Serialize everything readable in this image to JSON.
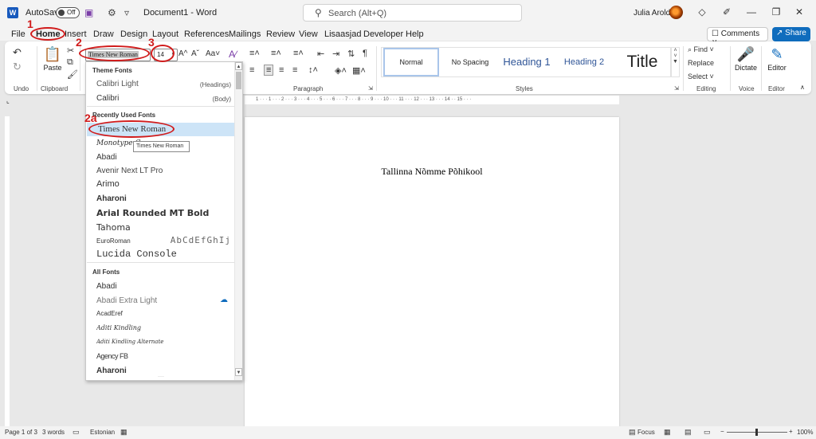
{
  "titlebar": {
    "app_icon": "W",
    "autosave_label": "AutoSave",
    "autosave_state": "Off",
    "doc_title": "Document1  -  Word",
    "search_placeholder": "Search (Alt+Q)",
    "user_name": "Julia Arold",
    "save_icon": "💾",
    "undo_icon": "⚙",
    "more_icon": "▿",
    "diamond_icon": "◇",
    "pen_icon": "✐",
    "minimize": "—",
    "restore": "❐",
    "close": "✕"
  },
  "menu": {
    "tabs": [
      "File",
      "Home",
      "Insert",
      "Draw",
      "Design",
      "Layout",
      "References",
      "Mailings",
      "Review",
      "View",
      "Lisaasjad",
      "Developer",
      "Help"
    ],
    "comments_label": "☐ Comments ∨",
    "share_label": "↗ Share"
  },
  "ribbon": {
    "undo_label": "Undo",
    "clipboard_label": "Clipboard",
    "paste_label": "Paste",
    "font_name": "Times New Roman",
    "font_size": "14",
    "grow_font": "A^",
    "shrink_font": "Aˇ",
    "change_case": "Aa˅",
    "paragraph_label": "Paragraph",
    "styles_label": "Styles",
    "editing_label": "Editing",
    "voice_label": "Voice",
    "editor_label": "Editor",
    "styles": {
      "normal": "Normal",
      "no_spacing": "No Spacing",
      "heading1": "Heading 1",
      "heading2": "Heading 2",
      "title": "Title"
    },
    "find_label": "⌕ Find ˅",
    "replace_label": "Replace",
    "select_label": "Select ˅",
    "dictate_label": "Dictate",
    "editor_btn_label": "Editor"
  },
  "ruler": {
    "marks": "1 · · · 1 · · · 2 · · · 3 · · · 4 · · · 5 · · · 6 · · · 7 · · · 8 · · · 9 · · · 10 · · · 11 · · · 12 · · · 13 · · · 14 · · 15 · · ·"
  },
  "document": {
    "text": "Tallinna Nõmme Põhikool"
  },
  "font_dropdown": {
    "theme_header": "Theme Fonts",
    "theme_fonts": [
      {
        "name": "Calibri Light",
        "note": "(Headings)"
      },
      {
        "name": "Calibri",
        "note": "(Body)"
      }
    ],
    "recent_header": "Recently Used Fonts",
    "recent_fonts": [
      "Times New Roman",
      "Monotype C",
      "Abadi",
      "Avenir Next LT Pro",
      "Arimo",
      "Aharoni",
      "Arial Rounded MT Bold",
      "Tahoma",
      "EuroRoman",
      "Lucida Console"
    ],
    "euroroman_sample": "AbCdEfGhIj",
    "all_header": "All Fonts",
    "all_fonts": [
      "Abadi",
      "Abadi Extra Light",
      "AcadEref",
      "Aditi Kindling",
      "Aditi Kindling Alternate",
      "Agency FB",
      "Aharoni"
    ],
    "tooltip": "Times New Roman"
  },
  "annotations": {
    "step1": "1",
    "step2": "2",
    "step2a": "2a",
    "step3": "3"
  },
  "statusbar": {
    "page": "Page 1 of 3",
    "words": "3 words",
    "language": "Estonian",
    "focus": "Focus",
    "zoom": "100%"
  },
  "colors": {
    "accent": "#0f6cbd",
    "annotation": "#d11b1b",
    "hover": "#cde4f7"
  }
}
